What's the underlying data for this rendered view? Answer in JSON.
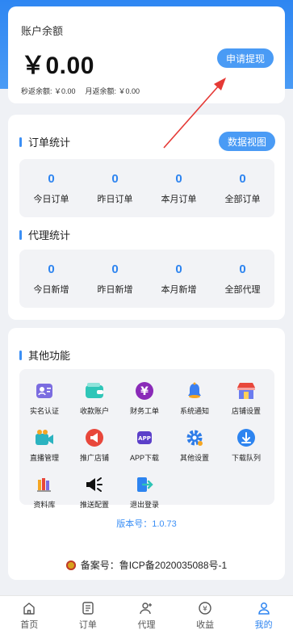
{
  "balance": {
    "title": "账户余额",
    "amount": "￥0.00",
    "withdraw_label": "申请提现",
    "second_rebate": "秒返余额: ￥0.00",
    "month_rebate": "月返余额: ￥0.00"
  },
  "orders": {
    "title": "订单统计",
    "view_label": "数据视图",
    "items": [
      {
        "value": "0",
        "label": "今日订单"
      },
      {
        "value": "0",
        "label": "昨日订单"
      },
      {
        "value": "0",
        "label": "本月订单"
      },
      {
        "value": "0",
        "label": "全部订单"
      }
    ]
  },
  "agents": {
    "title": "代理统计",
    "items": [
      {
        "value": "0",
        "label": "今日新增"
      },
      {
        "value": "0",
        "label": "昨日新增"
      },
      {
        "value": "0",
        "label": "本月新增"
      },
      {
        "value": "0",
        "label": "全部代理"
      }
    ]
  },
  "other": {
    "title": "其他功能",
    "functions": [
      {
        "label": "实名认证",
        "icon": "id-card-icon"
      },
      {
        "label": "收款账户",
        "icon": "wallet-icon"
      },
      {
        "label": "财务工单",
        "icon": "yen-icon"
      },
      {
        "label": "系统通知",
        "icon": "bell-icon"
      },
      {
        "label": "店铺设置",
        "icon": "store-icon"
      },
      {
        "label": "直播管理",
        "icon": "video-camera-icon"
      },
      {
        "label": "推广店铺",
        "icon": "megaphone-icon"
      },
      {
        "label": "APP下载",
        "icon": "app-icon"
      },
      {
        "label": "其他设置",
        "icon": "gear-icon"
      },
      {
        "label": "下载队列",
        "icon": "download-icon"
      },
      {
        "label": "资料库",
        "icon": "books-icon"
      },
      {
        "label": "推送配置",
        "icon": "speaker-icon"
      },
      {
        "label": "退出登录",
        "icon": "logout-icon"
      }
    ],
    "version": "版本号：1.0.73",
    "icp": "备案号：鲁ICP备2020035088号-1"
  },
  "tabbar": {
    "items": [
      {
        "label": "首页",
        "icon": "home-icon"
      },
      {
        "label": "订单",
        "icon": "order-icon"
      },
      {
        "label": "代理",
        "icon": "agent-icon"
      },
      {
        "label": "收益",
        "icon": "earnings-icon"
      },
      {
        "label": "我的",
        "icon": "user-icon"
      }
    ],
    "active": "我的"
  },
  "colors": {
    "accent": "#2d84f0",
    "header_gradient_top": "#2e86f2",
    "annotation_arrow": "#e53935"
  }
}
